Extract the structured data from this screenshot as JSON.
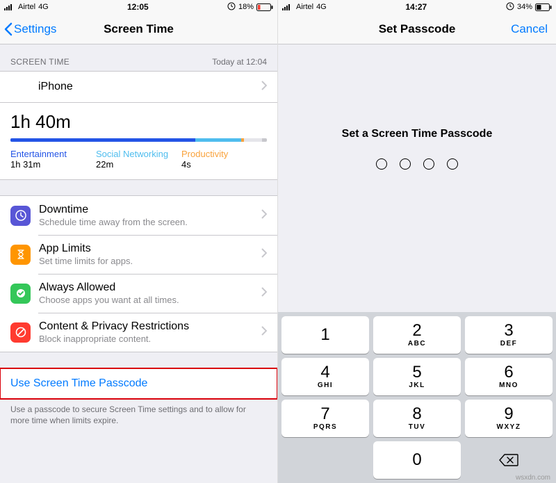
{
  "left": {
    "status": {
      "carrier": "Airtel",
      "net": "4G",
      "time": "12:05",
      "batt": "18%"
    },
    "nav": {
      "back": "Settings",
      "title": "Screen Time"
    },
    "section_header": "SCREEN TIME",
    "section_header_right": "Today at 12:04",
    "device": "iPhone",
    "usage_total": "1h 40m",
    "cats": [
      {
        "label": "Entertainment",
        "value": "1h 31m"
      },
      {
        "label": "Social Networking",
        "value": "22m"
      },
      {
        "label": "Productivity",
        "value": "4s"
      }
    ],
    "items": [
      {
        "title": "Downtime",
        "sub": "Schedule time away from the screen."
      },
      {
        "title": "App Limits",
        "sub": "Set time limits for apps."
      },
      {
        "title": "Always Allowed",
        "sub": "Choose apps you want at all times."
      },
      {
        "title": "Content & Privacy Restrictions",
        "sub": "Block inappropriate content."
      }
    ],
    "passcode_btn": "Use Screen Time Passcode",
    "footer": "Use a passcode to secure Screen Time settings and to allow for more time when limits expire."
  },
  "right": {
    "status": {
      "carrier": "Airtel",
      "net": "4G",
      "time": "14:27",
      "batt": "34%"
    },
    "nav": {
      "title": "Set Passcode",
      "cancel": "Cancel"
    },
    "prompt": "Set a Screen Time Passcode",
    "keys": [
      {
        "n": "1",
        "l": ""
      },
      {
        "n": "2",
        "l": "ABC"
      },
      {
        "n": "3",
        "l": "DEF"
      },
      {
        "n": "4",
        "l": "GHI"
      },
      {
        "n": "5",
        "l": "JKL"
      },
      {
        "n": "6",
        "l": "MNO"
      },
      {
        "n": "7",
        "l": "PQRS"
      },
      {
        "n": "8",
        "l": "TUV"
      },
      {
        "n": "9",
        "l": "WXYZ"
      },
      {
        "n": "0",
        "l": ""
      }
    ]
  },
  "watermark": "wsxdn.com"
}
